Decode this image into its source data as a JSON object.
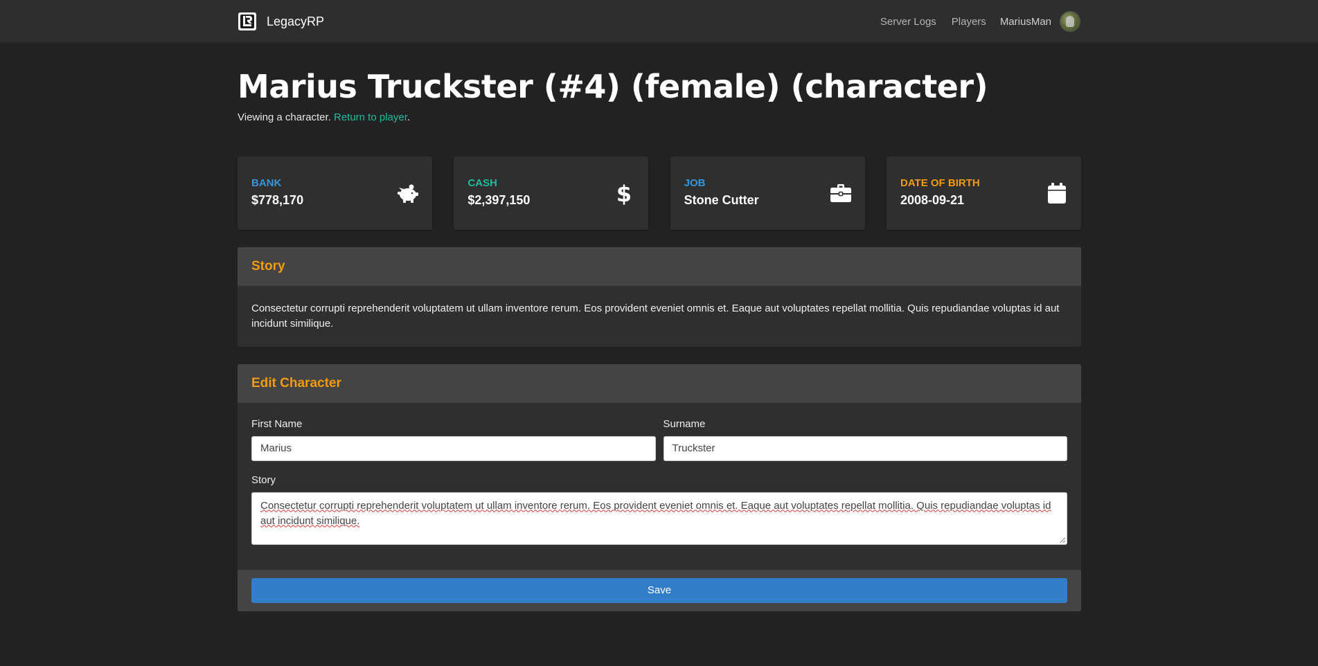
{
  "nav": {
    "brand": "LegacyRP",
    "links": [
      "Server Logs",
      "Players"
    ],
    "username": "MariusMan"
  },
  "page": {
    "title": "Marius Truckster (#4) (female) (character)",
    "subtitle_prefix": "Viewing a character. ",
    "subtitle_link": "Return to player",
    "subtitle_suffix": "."
  },
  "stats": [
    {
      "label": "BANK",
      "value": "$778,170",
      "color": "#3498db",
      "icon": "piggy-bank-icon"
    },
    {
      "label": "CASH",
      "value": "$2,397,150",
      "color": "#1fbc9c",
      "icon": "dollar-icon"
    },
    {
      "label": "JOB",
      "value": "Stone Cutter",
      "color": "#3498db",
      "icon": "briefcase-icon"
    },
    {
      "label": "DATE OF BIRTH",
      "value": "2008-09-21",
      "color": "#f39c12",
      "icon": "calendar-icon"
    }
  ],
  "story_card": {
    "title": "Story",
    "text": "Consectetur corrupti reprehenderit voluptatem ut ullam inventore rerum. Eos provident eveniet omnis et. Eaque aut voluptates repellat mollitia. Quis repudiandae voluptas id aut incidunt similique."
  },
  "edit_card": {
    "title": "Edit Character",
    "first_name_label": "First Name",
    "first_name_value": "Marius",
    "surname_label": "Surname",
    "surname_value": "Truckster",
    "story_label": "Story",
    "story_value": "Consectetur corrupti reprehenderit voluptatem ut ullam inventore rerum. Eos provident eveniet omnis et. Eaque aut voluptates repellat mollitia. Quis repudiandae voluptas id aut incidunt similique.",
    "save_label": "Save"
  }
}
